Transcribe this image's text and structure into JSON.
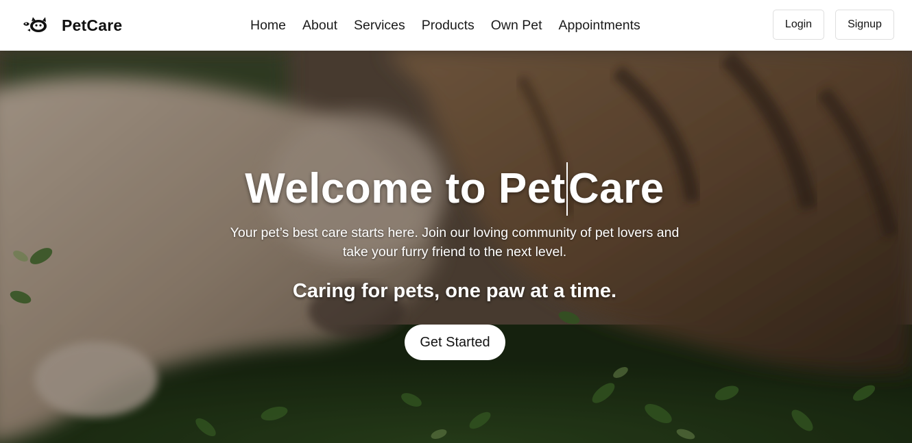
{
  "brand": {
    "name": "PetCare",
    "logo_icon": "pet-paw-logo-icon"
  },
  "nav": {
    "links": [
      "Home",
      "About",
      "Services",
      "Products",
      "Own Pet",
      "Appointments"
    ]
  },
  "auth": {
    "login_label": "Login",
    "signup_label": "Signup"
  },
  "hero": {
    "title_part1": "Welcome to Pet",
    "title_part2": "Care",
    "subtitle": "Your pet’s best care starts here. Join our loving community of pet lovers and take your furry friend to the next level.",
    "tagline": "Caring for pets, one paw at a time.",
    "cta_label": "Get Started",
    "background_image": "cat-lying-in-grass-photo"
  },
  "colors": {
    "navbar_bg": "#ffffff",
    "text_dark": "#111111",
    "hero_text": "#ffffff",
    "cta_bg": "#ffffff"
  }
}
